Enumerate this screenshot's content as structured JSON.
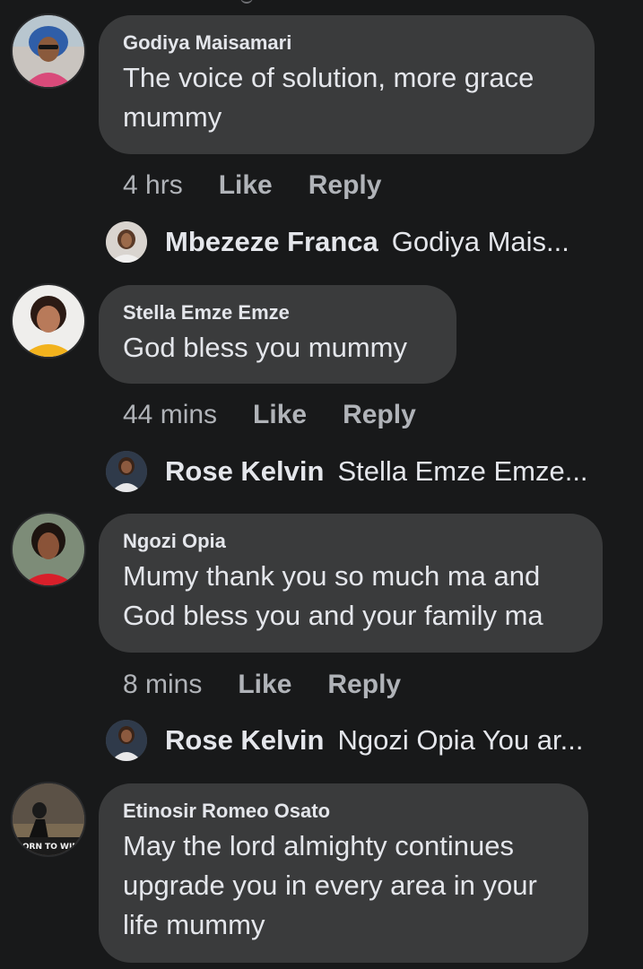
{
  "comments": [
    {
      "author": "Godiya Maisamari",
      "avatar_icon": "profile-photo",
      "text": "The voice of solution, more grace\nmummy",
      "time": "4 hrs",
      "like_label": "Like",
      "reply_label": "Reply",
      "reply": {
        "author": "Mbezeze Franca",
        "preview": "Godiya Mais...",
        "avatar_icon": "profile-photo"
      }
    },
    {
      "author": "Stella Emze Emze",
      "avatar_icon": "profile-photo",
      "text": "God bless you mummy",
      "time": "44 mins",
      "like_label": "Like",
      "reply_label": "Reply",
      "reply": {
        "author": "Rose Kelvin",
        "preview": "Stella Emze Emze...",
        "avatar_icon": "profile-photo"
      }
    },
    {
      "author": "Ngozi Opia",
      "avatar_icon": "profile-photo",
      "text": "Mumy thank you so much ma and\nGod bless you and your family ma",
      "time": "8 mins",
      "like_label": "Like",
      "reply_label": "Reply",
      "reply": {
        "author": "Rose Kelvin",
        "preview": "Ngozi Opia You ar...",
        "avatar_icon": "profile-photo"
      }
    },
    {
      "author": "Etinosir Romeo Osato",
      "avatar_icon": "profile-photo",
      "avatar_caption": "BORN TO WIN",
      "text": "May the lord almighty continues\nupgrade you in every area in your\nlife mummy"
    }
  ]
}
